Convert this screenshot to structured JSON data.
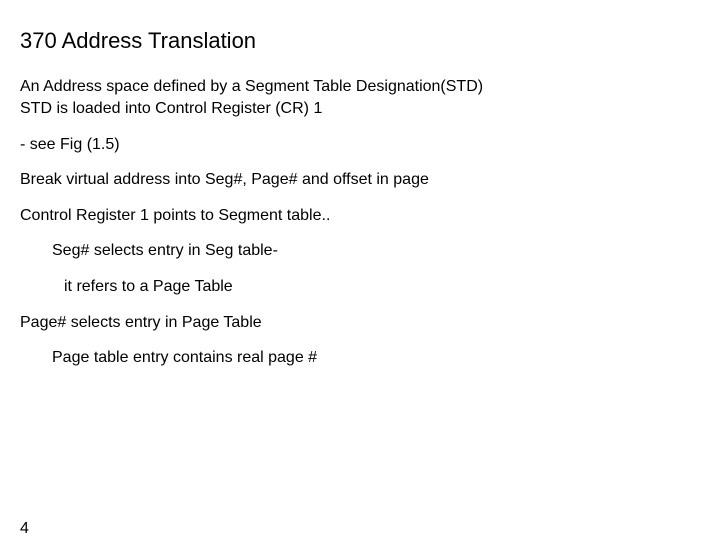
{
  "title": "370 Address Translation",
  "lines": {
    "l1": "An Address space defined by a Segment Table Designation(STD)",
    "l2": "STD is loaded into Control Register (CR) 1",
    "l3": "- see Fig (1.5)",
    "l4": "Break virtual address into Seg#, Page# and offset in page",
    "l5": "Control Register 1 points to Segment table..",
    "l6": "Seg# selects entry in Seg table-",
    "l7": "it refers to a Page Table",
    "l8": "Page# selects entry in Page Table",
    "l9": "Page table entry contains real page #"
  },
  "pageNumber": "4"
}
